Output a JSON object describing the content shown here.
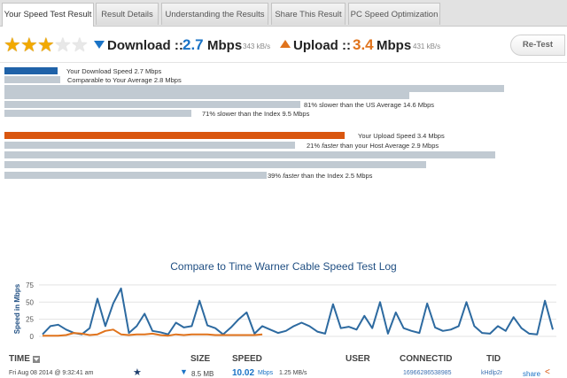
{
  "tabs": [
    {
      "label": "Your Speed Test Result",
      "active": true
    },
    {
      "label": "Result Details",
      "active": false
    },
    {
      "label": "Understanding the Results",
      "active": false
    },
    {
      "label": "Share This Result",
      "active": false
    },
    {
      "label": "PC Speed Optimization",
      "active": false
    }
  ],
  "rating": {
    "stars": 3,
    "max": 5
  },
  "download": {
    "label": "Download ::",
    "value": "2.7",
    "unit": "Mbps",
    "kbs": "343 kB/s",
    "color": "#1a73c6"
  },
  "upload": {
    "label": "Upload ::",
    "value": "3.4",
    "unit": "Mbps",
    "kbs": "431 kB/s",
    "color": "#e0731c"
  },
  "retest_label": "Re-Test",
  "download_bars": [
    {
      "text": "Your Download Speed 2.7 Mbps",
      "pct": 9.5
    },
    {
      "text": "Comparable to Your Average 2.8 Mbps",
      "pct": 10
    },
    {
      "text": "",
      "pct": 89.5
    },
    {
      "pre": "81% slower than the US Average 14.6 Mbps",
      "pct": 72.5
    },
    {
      "pre": "71% slower than the Index 9.5 Mbps",
      "pct": 33.5
    }
  ],
  "upload_bars": [
    {
      "text": "Your Upload Speed 3.4 Mbps",
      "pct": 61
    },
    {
      "pre_a": "21% ",
      "pre_em": "faster",
      "pre_b": " than your Host Average 2.9 Mbps",
      "pct": 52
    },
    {
      "text": "",
      "pct": 88
    },
    {
      "text": "",
      "pct": 75.5
    },
    {
      "pre_a": "39% ",
      "pre_em": "faster",
      "pre_b": " than the Index 2.5 Mbps",
      "pct": 47
    }
  ],
  "chart_data": {
    "type": "line",
    "title": "Compare to Time Warner Cable Speed Test Log",
    "ylabel": "Speed in Mbps",
    "ylim": [
      0,
      80
    ],
    "yticks": [
      "0",
      "25",
      "50",
      "75"
    ],
    "grid": true,
    "series": [
      {
        "color": "#2d6aa0",
        "values": [
          3,
          15,
          17,
          10,
          5,
          3,
          12,
          55,
          15,
          48,
          70,
          5,
          15,
          33,
          8,
          6,
          3,
          20,
          13,
          15,
          52,
          16,
          12,
          3,
          13,
          25,
          35,
          4,
          15,
          10,
          5,
          8,
          15,
          20,
          15,
          7,
          4,
          47,
          12,
          14,
          10,
          30,
          12,
          50,
          4,
          35,
          12,
          8,
          5,
          48,
          13,
          8,
          10,
          15,
          50,
          15,
          5,
          4,
          15,
          8,
          28,
          12,
          4,
          3,
          52,
          10
        ]
      },
      {
        "color": "#e0731c",
        "values": [
          1,
          1,
          1,
          2,
          5,
          4,
          2,
          3,
          8,
          10,
          3,
          2,
          3,
          3,
          4,
          2,
          1,
          3,
          2,
          3,
          3,
          3,
          2,
          2,
          2,
          2,
          2,
          2,
          3
        ]
      }
    ]
  },
  "log": {
    "headers": {
      "time": "TIME",
      "size": "SIZE",
      "speed": "SPEED",
      "user": "USER",
      "connect": "CONNECTID",
      "tid": "TID"
    },
    "row": {
      "time": "Fri Aug 08 2014 @ 9:32:41 am",
      "size": "8.5 MB",
      "speed": "10.02",
      "speed_unit": "Mbps",
      "speed_kbs": "1.25 MB/s",
      "connect": "16966286538985",
      "tid": "kHdlp2r",
      "share": "share"
    }
  }
}
